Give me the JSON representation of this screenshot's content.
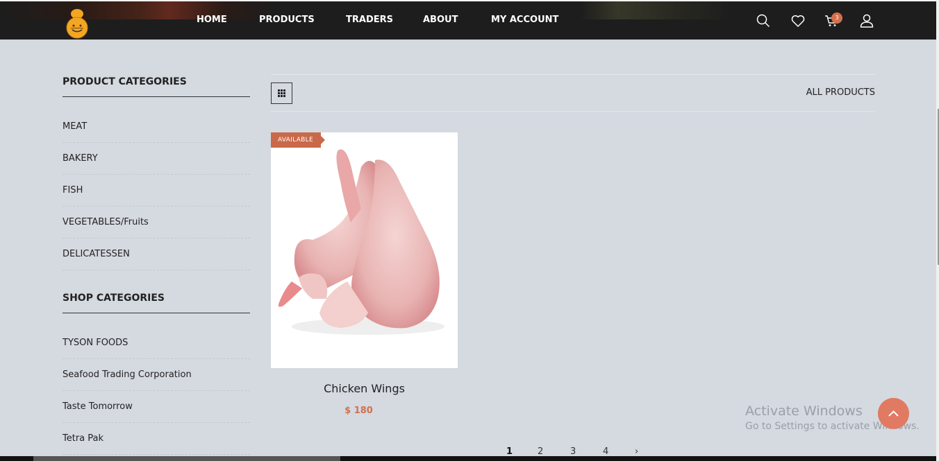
{
  "nav": {
    "home": "HOME",
    "products": "PRODUCTS",
    "traders": "TRADERS",
    "about": "ABOUT",
    "my_account": "MY ACCOUNT"
  },
  "header": {
    "cart_count": "3",
    "icons": [
      "search-icon",
      "heart-icon",
      "cart-icon",
      "user-icon"
    ]
  },
  "sidebar": {
    "product_categories_title": "PRODUCT CATEGORIES",
    "product_categories": [
      "MEAT",
      "BAKERY",
      "FISH",
      "VEGETABLES/Fruits",
      "DELICATESSEN"
    ],
    "shop_categories_title": "SHOP CATEGORIES",
    "shop_categories": [
      "TYSON FOODS",
      "Seafood Trading Corporation",
      "Taste Tomorrow",
      "Tetra Pak"
    ]
  },
  "toolbar": {
    "view": "grid-icon",
    "all_products": "ALL PRODUCTS"
  },
  "product": {
    "badge": "AVAILABLE",
    "name": "Chicken Wings",
    "price": "$ 180"
  },
  "pagination": {
    "pages": [
      "1",
      "2",
      "3",
      "4"
    ],
    "next": "›"
  },
  "watermark": {
    "title": "Activate Windows",
    "subtitle": "Go to Settings to activate Windows."
  },
  "colors": {
    "accent": "#d4704b",
    "header_bg": "#1d1d1d",
    "page_bg": "#d5d9e0"
  }
}
